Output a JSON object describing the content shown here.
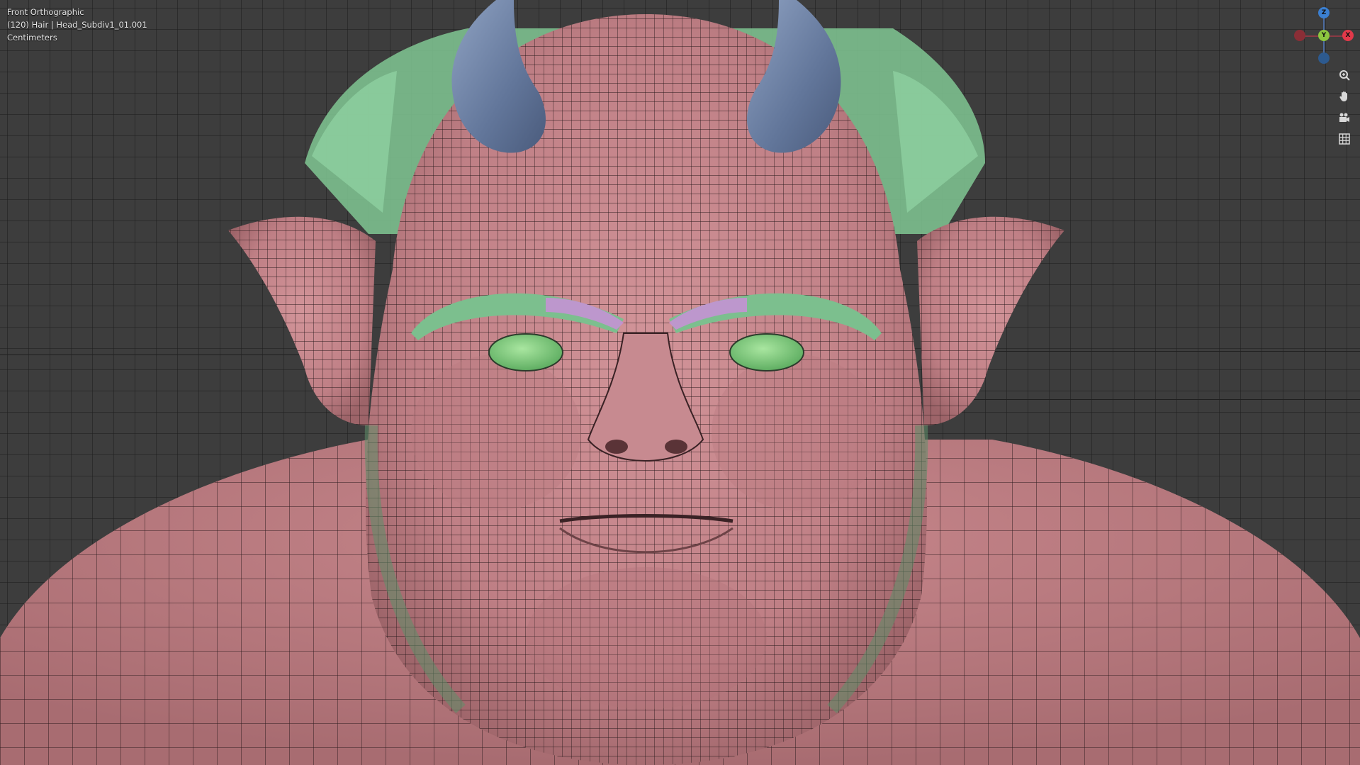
{
  "viewport": {
    "view_name": "Front Orthographic",
    "object_info": "(120) Hair | Head_Subdiv1_01.001",
    "units": "Centimeters"
  },
  "gizmo": {
    "z_label": "Z",
    "y_label": "Y",
    "x_label": "X",
    "colors": {
      "x": "#e2394a",
      "y": "#8cc63f",
      "z": "#3b7fd0",
      "neg_x": "#8a2e36",
      "neg_z": "#2d5a8f"
    }
  },
  "nav_buttons": [
    {
      "icon": "zoom-icon"
    },
    {
      "icon": "hand-pan-icon"
    },
    {
      "icon": "camera-icon"
    },
    {
      "icon": "grid-icon"
    }
  ],
  "colors": {
    "skin": "#c98a8f",
    "hair": "#7cbf8e",
    "horn": "#6a7fa2",
    "eye": "#7fcf7c",
    "brow_highlight": "#c98fd8",
    "background": "#3d3d3d"
  }
}
